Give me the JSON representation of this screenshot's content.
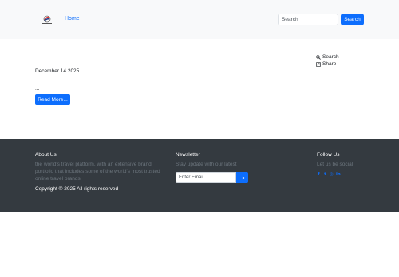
{
  "header": {
    "logo_icon": "brand-logo-icon",
    "nav_home": "Home",
    "search_placeholder": "Search",
    "search_button": "Search"
  },
  "post": {
    "date": "December 14 2025",
    "excerpt": "...",
    "read_more": "Read More..."
  },
  "sidebar": {
    "actions": [
      {
        "icon": "search-icon",
        "label": "Search"
      },
      {
        "icon": "share-icon",
        "label": "Share"
      }
    ]
  },
  "footer": {
    "about": {
      "title": "About Us",
      "text": "the world's travel platform, with an extensive brand portfolio that includes some of the world's most trusted online travel brands."
    },
    "copyright": "Copyright © 2025 All rights reserved",
    "newsletter": {
      "title": "Newsletter",
      "text": "Stay update with our latest",
      "email_placeholder": "Enter Email",
      "submit_icon": "arrow-right-icon"
    },
    "follow": {
      "title": "Follow Us",
      "text": "Let us be social",
      "socials": [
        {
          "icon": "facebook-icon",
          "glyph": "f"
        },
        {
          "icon": "twitter-icon",
          "glyph": "t"
        },
        {
          "icon": "instagram-icon",
          "glyph": "◎"
        },
        {
          "icon": "linkedin-icon",
          "glyph": "in"
        }
      ]
    }
  },
  "colors": {
    "primary": "#0d6efd",
    "navbar_bg": "#f8f9fa",
    "footer_bg": "#343a40",
    "muted_text": "#6c757d"
  }
}
